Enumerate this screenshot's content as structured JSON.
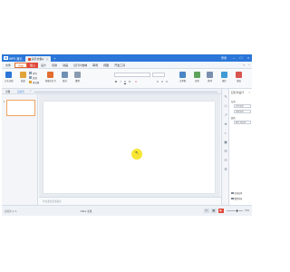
{
  "app": {
    "brand": "WPS 演示",
    "doc_tab": "演示文稿1",
    "new_tab": "+",
    "account": "登录",
    "window_controls": [
      "–",
      "□",
      "×"
    ]
  },
  "menu": {
    "items": [
      "文件",
      "开始",
      "插入",
      "设计",
      "切换",
      "动画",
      "幻灯片放映",
      "审阅",
      "视图",
      "开发工具"
    ],
    "active_index": 1,
    "highlight_index": 2
  },
  "ribbon": {
    "buttons": [
      {
        "label": "从头开始",
        "icon": "play-slide-icon",
        "color": "#2b76d8"
      },
      {
        "label": "粘贴",
        "icon": "paste-icon",
        "color": "#e2a33a"
      },
      {
        "label": "新建幻灯片",
        "icon": "new-slide-icon",
        "color": "#e26d2f"
      },
      {
        "label": "版式",
        "icon": "layout-icon",
        "color": "#6f8fb5"
      },
      {
        "label": "重置",
        "icon": "reset-icon",
        "color": "#8a9bb0"
      },
      {
        "label": "文本框",
        "icon": "textbox-icon",
        "color": "#4a86c5"
      },
      {
        "label": "形状",
        "icon": "shape-icon",
        "color": "#5ca45c"
      },
      {
        "label": "排列",
        "icon": "arrange-icon",
        "color": "#7a8fb0"
      },
      {
        "label": "图片",
        "icon": "picture-icon",
        "color": "#3d9bd6"
      },
      {
        "label": "填充",
        "icon": "fill-icon",
        "color": "#d9534f"
      }
    ],
    "small": [
      "剪切",
      "复制",
      "格式刷"
    ],
    "font_name": "",
    "font_size": ""
  },
  "panes": {
    "outline_tabs": [
      "大纲",
      "幻灯片"
    ],
    "close": "×"
  },
  "thumbnails": [
    {
      "number": "1"
    }
  ],
  "notes_placeholder": "单击此处添加备注",
  "right_panel": {
    "title": "幻灯片设计",
    "close": "×",
    "section_label": "背景",
    "options": [
      "纯色填充",
      "渐变填充",
      "图片或纹理"
    ],
    "fill_label": "颜色",
    "apply_all": "全部应用",
    "reset": "重置背景"
  },
  "status": {
    "slide_info": "幻灯片 1 / 1",
    "theme": "Office 主题",
    "zoom": "71%"
  },
  "colors": {
    "titlebar": "#2b76d8",
    "accent": "#e26d2f",
    "highlight": "#e04a3b",
    "click_marker": "#f7e31e"
  }
}
